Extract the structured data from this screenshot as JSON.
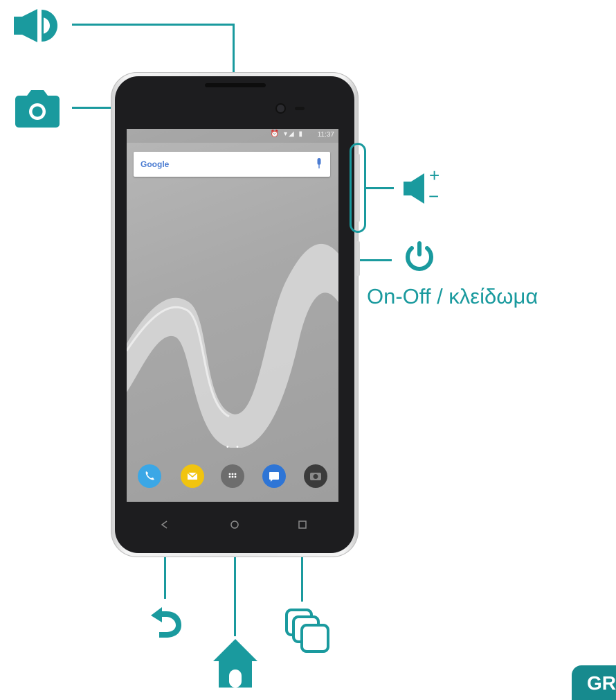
{
  "diagram": {
    "accent_color": "#1a9a9e",
    "callouts": [
      {
        "name": "speaker",
        "icon": "speaker-icon"
      },
      {
        "name": "camera",
        "icon": "camera-icon"
      },
      {
        "name": "volume",
        "icon": "volume-icon",
        "plus": "+",
        "minus": "−"
      },
      {
        "name": "power",
        "icon": "power-icon",
        "label": "On-Off / κλείδωμα"
      },
      {
        "name": "back",
        "icon": "back-arrow-icon"
      },
      {
        "name": "home",
        "icon": "home-icon"
      },
      {
        "name": "recent-apps",
        "icon": "recent-apps-icon"
      }
    ]
  },
  "phone_screen": {
    "status_time": "11:37",
    "status_icons": "⏰ ▾◢ ▮",
    "search_logo": "Google",
    "page_dots": "• •"
  },
  "corner_tab": {
    "text": "GR",
    "color": "#178a8e"
  }
}
